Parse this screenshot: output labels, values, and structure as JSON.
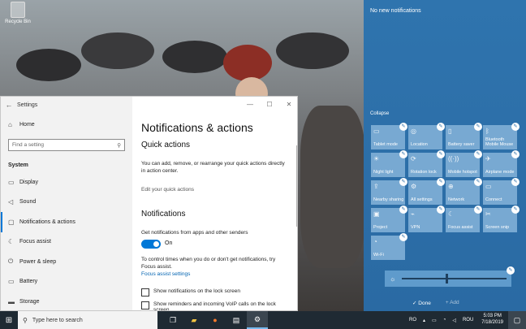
{
  "desktop": {
    "recycle_bin_label": "Recycle Bin"
  },
  "settings": {
    "window_title": "Settings",
    "controls": {
      "minimize": "—",
      "maximize": "☐",
      "close": "✕"
    },
    "home_label": "Home",
    "search_placeholder": "Find a setting",
    "section_label": "System",
    "nav_items": [
      {
        "label": "Display",
        "icon": "display-icon"
      },
      {
        "label": "Sound",
        "icon": "sound-icon"
      },
      {
        "label": "Notifications & actions",
        "icon": "notifications-icon"
      },
      {
        "label": "Focus assist",
        "icon": "focus-assist-icon"
      },
      {
        "label": "Power & sleep",
        "icon": "power-icon"
      },
      {
        "label": "Battery",
        "icon": "battery-icon"
      },
      {
        "label": "Storage",
        "icon": "storage-icon"
      }
    ],
    "page_title": "Notifications & actions",
    "quick_actions_heading": "Quick actions",
    "quick_actions_desc": "You can add, remove, or rearrange your quick actions directly in action center.",
    "edit_quick_actions": "Edit your quick actions",
    "notifications_heading": "Notifications",
    "get_notifications_label": "Get notifications from apps and other senders",
    "toggle_state": "On",
    "focus_text": "To control times when you do or don't get notifications, try Focus assist.",
    "focus_link": "Focus assist settings",
    "checkbox_1": "Show notifications on the lock screen",
    "checkbox_2": "Show reminders and incoming VoIP calls on the lock screen"
  },
  "action_center": {
    "no_notifications": "No new notifications",
    "collapse": "Collapse",
    "tiles": [
      {
        "label": "Tablet mode",
        "icon": "tablet-icon"
      },
      {
        "label": "Location",
        "icon": "location-icon"
      },
      {
        "label": "Battery saver",
        "icon": "battery-saver-icon"
      },
      {
        "label": "Bluetooth Mobile Mouse",
        "icon": "bluetooth-icon"
      },
      {
        "label": "Night light",
        "icon": "night-light-icon"
      },
      {
        "label": "Rotation lock",
        "icon": "rotation-lock-icon"
      },
      {
        "label": "Mobile hotspot",
        "icon": "hotspot-icon"
      },
      {
        "label": "Airplane mode",
        "icon": "airplane-icon"
      },
      {
        "label": "Nearby sharing",
        "icon": "nearby-sharing-icon"
      },
      {
        "label": "All settings",
        "icon": "settings-icon"
      },
      {
        "label": "Network",
        "icon": "network-icon"
      },
      {
        "label": "Connect",
        "icon": "connect-icon"
      },
      {
        "label": "Project",
        "icon": "project-icon"
      },
      {
        "label": "VPN",
        "icon": "vpn-icon"
      },
      {
        "label": "Focus assist",
        "icon": "moon-icon"
      },
      {
        "label": "Screen snip",
        "icon": "snip-icon"
      },
      {
        "label": "Wi-Fi",
        "icon": "wifi-icon"
      }
    ],
    "brightness_level": 0.42,
    "done_label": "Done",
    "add_label": "Add"
  },
  "taskbar": {
    "search_placeholder": "Type here to search",
    "language": "RO",
    "input_lang": "ROU",
    "time": "5:03 PM",
    "date": "7/18/2019"
  }
}
